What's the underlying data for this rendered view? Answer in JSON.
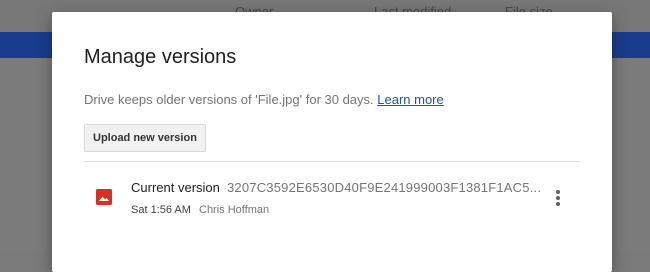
{
  "background": {
    "columns": [
      "Owner",
      "Last modified",
      "File size"
    ]
  },
  "dialog": {
    "title": "Manage versions",
    "description": "Drive keeps older versions of 'File.jpg' for 30 days. ",
    "learn_more": "Learn more",
    "upload_button": "Upload new version"
  },
  "versions": [
    {
      "label": "Current version",
      "hash": "3207C3592E6530D40F9E241999003F1381F1AC5...",
      "time": "Sat 1:56 AM",
      "author": "Chris Hoffman",
      "icon": "image-file-icon",
      "icon_color": "#d93025"
    }
  ],
  "colors": {
    "accent_blue": "#1a3c8e",
    "link": "#1a55b5"
  }
}
